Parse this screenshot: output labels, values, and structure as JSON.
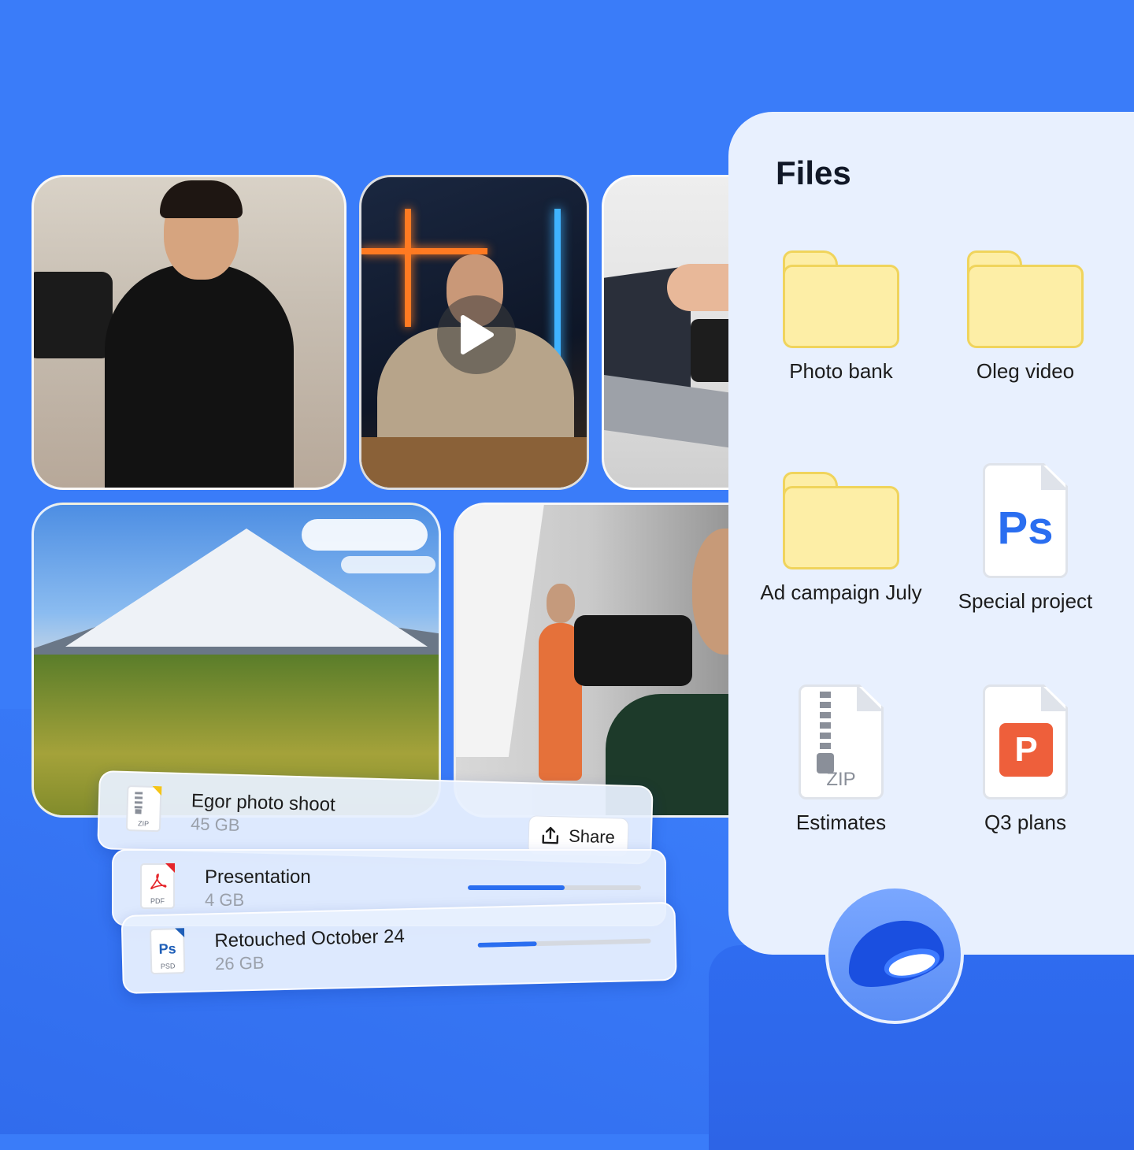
{
  "colors": {
    "background": "#3a7cf9",
    "panel": "#e8f0fe",
    "folder_fill": "#fdeea6",
    "folder_border": "#f0d45c",
    "accent": "#2a6ef0",
    "pptx": "#ee5f3b",
    "pdf": "#e5252a"
  },
  "media": {
    "presenter_photo": "presenter-photo",
    "streamer_video": "play-icon",
    "laptop_photo": "laptop-photo",
    "mountain_photo": "mountain-photo",
    "camera_photo": "photographer-photo"
  },
  "files_panel": {
    "title": "Files",
    "items": [
      {
        "label": "Photo bank",
        "icon": "folder-icon"
      },
      {
        "label": "Oleg video",
        "icon": "folder-icon"
      },
      {
        "label": "Ad campaign July",
        "icon": "folder-icon"
      },
      {
        "label": "Special project",
        "icon": "psd-file-icon",
        "glyph": "Ps"
      },
      {
        "label": "Estimates",
        "icon": "zip-file-icon",
        "glyph": "ZIP"
      },
      {
        "label": "Q3 plans",
        "icon": "pptx-file-icon",
        "glyph": "P"
      }
    ]
  },
  "transfers": [
    {
      "name": "Egor photo shoot",
      "size": "45 GB",
      "icon": "zip-file-icon",
      "ext": "ZIP",
      "action": "Share"
    },
    {
      "name": "Presentation",
      "size": "4 GB",
      "icon": "pdf-file-icon",
      "ext": "PDF",
      "progress": 0.56
    },
    {
      "name": "Retouched October 24",
      "size": "26 GB",
      "icon": "psd-file-icon",
      "ext": "PSD",
      "glyph": "Ps",
      "progress": 0.34
    }
  ],
  "logo": "cloud-disk-logo-icon"
}
